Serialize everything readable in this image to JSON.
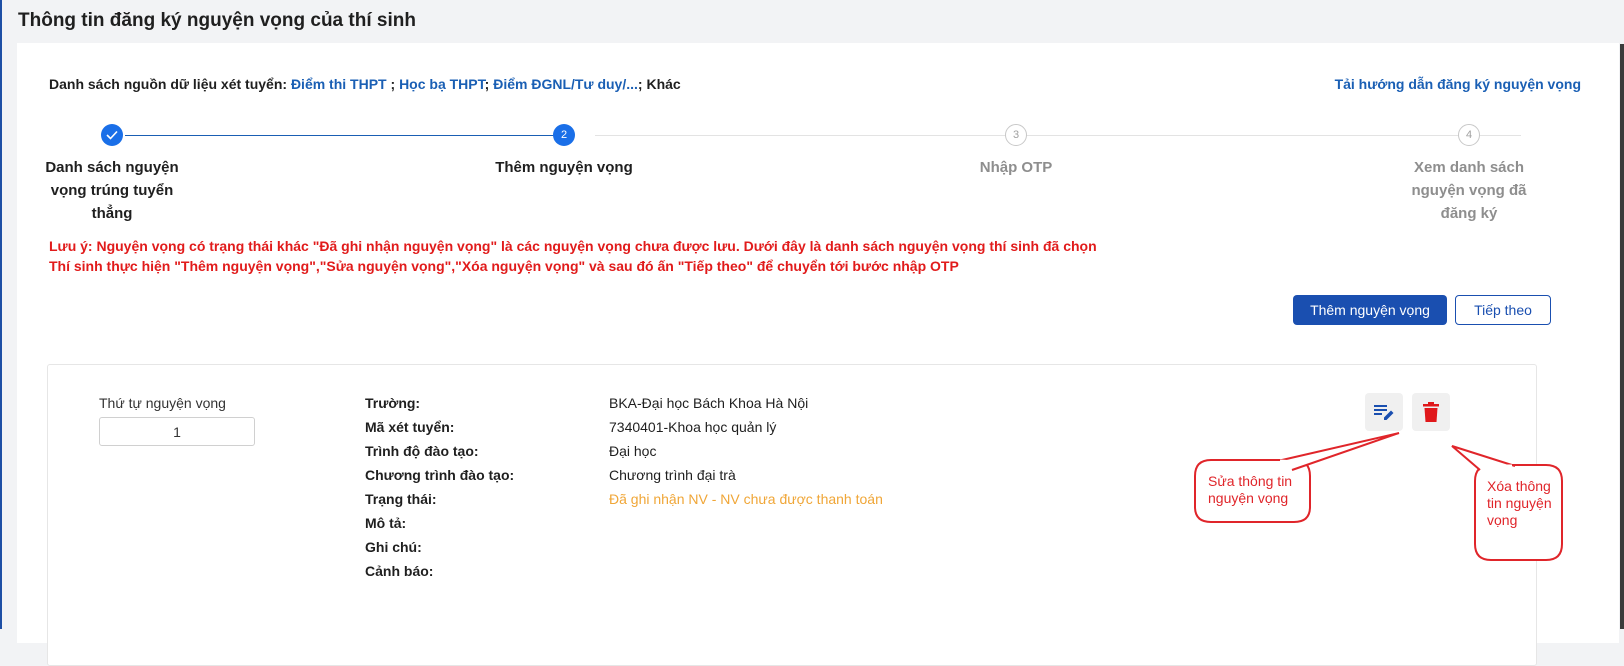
{
  "page": {
    "title": "Thông tin đăng ký nguyện vọng của thí sinh"
  },
  "sources": {
    "prefix": "Danh sách nguồn dữ liệu xét tuyển: ",
    "link1": "Điểm thi THPT",
    "sep1": " ; ",
    "link2": "Học bạ THPT",
    "sep2": "; ",
    "link3": "Điểm ĐGNL/Tư duy/...",
    "sep3": "; ",
    "other": "Khác"
  },
  "guide_link": "Tải hướng dẫn đăng ký nguyện vọng",
  "stepper": {
    "steps": [
      {
        "label": "Danh sách nguyện vọng trúng tuyển thẳng",
        "status": "done",
        "marker": "check-icon"
      },
      {
        "label": "Thêm nguyện vọng",
        "status": "active",
        "marker": "2"
      },
      {
        "label": "Nhập OTP",
        "status": "pending",
        "marker": "3"
      },
      {
        "label": "Xem danh sách nguyện vọng đã đăng ký",
        "status": "pending",
        "marker": "4"
      }
    ]
  },
  "notes": {
    "line1": "Lưu ý: Nguyện vọng có trạng thái khác \"Đã ghi nhận nguyện vọng\" là các nguyện vọng chưa được lưu. Dưới đây là danh sách nguyện vọng thí sinh đã chọn",
    "line2": "Thí sinh thực hiện \"Thêm nguyện vọng\",\"Sửa nguyện vọng\",\"Xóa nguyện vọng\" và sau đó ấn \"Tiếp theo\" để chuyển tới bước nhập OTP"
  },
  "actions": {
    "add": "Thêm nguyện vọng",
    "next": "Tiếp theo"
  },
  "wish": {
    "order_label": "Thứ tự nguyện vọng",
    "order_value": "1",
    "fields": [
      {
        "label": "Trường:",
        "value": "BKA-Đại học Bách Khoa Hà Nội"
      },
      {
        "label": "Mã xét tuyển:",
        "value": "7340401-Khoa học quản lý"
      },
      {
        "label": "Trình độ đào tạo:",
        "value": "Đại học"
      },
      {
        "label": "Chương trình đào tạo:",
        "value": "Chương trình đại trà"
      },
      {
        "label": "Trạng thái:",
        "value": "Đã ghi nhận NV - NV chưa được thanh toán"
      },
      {
        "label": "Mô tả:",
        "value": ""
      },
      {
        "label": "Ghi chú:",
        "value": ""
      },
      {
        "label": "Cảnh báo:",
        "value": ""
      }
    ]
  },
  "callouts": {
    "edit_line1": "Sửa thông tin",
    "edit_line2": "nguyện vọng",
    "delete_line1": "Xóa thông",
    "delete_line2": "tin nguyện",
    "delete_line3": "vọng"
  },
  "colors": {
    "primary": "#1a4fb0",
    "link": "#1a5fb4",
    "warning_red": "#e11b1b",
    "status_orange": "#f0a637",
    "delete_red": "#e0181b"
  },
  "icons": {
    "edit": "edit-note-icon",
    "delete": "trash-icon",
    "check": "check-icon"
  }
}
